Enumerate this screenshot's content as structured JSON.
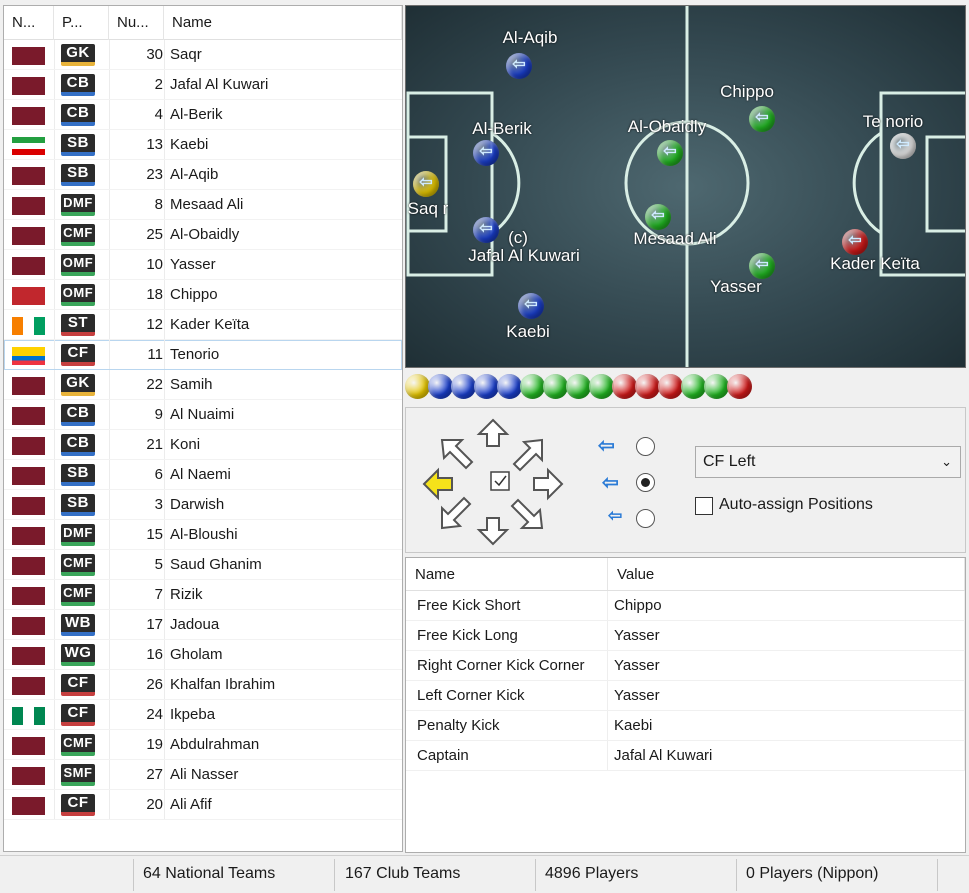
{
  "list_headers": [
    "N...",
    "P...",
    "Nu...",
    "Name"
  ],
  "players": [
    {
      "pos": "GK",
      "num": "30",
      "name": "Saqr",
      "cat": "gk",
      "flag": "maroon"
    },
    {
      "pos": "CB",
      "num": "2",
      "name": "Jafal Al Kuwari",
      "cat": "df",
      "flag": "maroon"
    },
    {
      "pos": "CB",
      "num": "4",
      "name": "Al-Berik",
      "cat": "df",
      "flag": "maroon"
    },
    {
      "pos": "SB",
      "num": "13",
      "name": "Kaebi",
      "cat": "df",
      "flag": "iran"
    },
    {
      "pos": "SB",
      "num": "23",
      "name": "Al-Aqib",
      "cat": "df",
      "flag": "maroon"
    },
    {
      "pos": "DMF",
      "num": "8",
      "name": "Mesaad Ali",
      "cat": "mf",
      "flag": "maroon"
    },
    {
      "pos": "CMF",
      "num": "25",
      "name": "Al-Obaidly",
      "cat": "mf",
      "flag": "maroon"
    },
    {
      "pos": "OMF",
      "num": "10",
      "name": "Yasser",
      "cat": "mf",
      "flag": "maroon"
    },
    {
      "pos": "OMF",
      "num": "18",
      "name": "Chippo",
      "cat": "mf",
      "flag": "morocco"
    },
    {
      "pos": "ST",
      "num": "12",
      "name": "Kader Keïta",
      "cat": "fw",
      "flag": "ivory"
    },
    {
      "pos": "CF",
      "num": "11",
      "name": "Tenorio",
      "cat": "fw",
      "flag": "ecuador"
    },
    {
      "pos": "GK",
      "num": "22",
      "name": "Samih",
      "cat": "gk",
      "flag": "maroon"
    },
    {
      "pos": "CB",
      "num": "9",
      "name": "Al Nuaimi",
      "cat": "df",
      "flag": "maroon"
    },
    {
      "pos": "CB",
      "num": "21",
      "name": "Koni",
      "cat": "df",
      "flag": "maroon"
    },
    {
      "pos": "SB",
      "num": "6",
      "name": "Al Naemi",
      "cat": "df",
      "flag": "maroon"
    },
    {
      "pos": "SB",
      "num": "3",
      "name": "Darwish",
      "cat": "df",
      "flag": "maroon"
    },
    {
      "pos": "DMF",
      "num": "15",
      "name": "Al-Bloushi",
      "cat": "mf",
      "flag": "maroon"
    },
    {
      "pos": "CMF",
      "num": "5",
      "name": "Saud Ghanim",
      "cat": "mf",
      "flag": "maroon"
    },
    {
      "pos": "CMF",
      "num": "7",
      "name": "Rizik",
      "cat": "mf",
      "flag": "maroon"
    },
    {
      "pos": "WB",
      "num": "17",
      "name": "Jadoua",
      "cat": "df",
      "flag": "maroon"
    },
    {
      "pos": "WG",
      "num": "16",
      "name": "Gholam",
      "cat": "mf",
      "flag": "maroon"
    },
    {
      "pos": "CF",
      "num": "26",
      "name": "Khalfan Ibrahim",
      "cat": "fw",
      "flag": "maroon"
    },
    {
      "pos": "CF",
      "num": "24",
      "name": "Ikpeba",
      "cat": "fw",
      "flag": "nigeria"
    },
    {
      "pos": "CMF",
      "num": "19",
      "name": "Abdulrahman",
      "cat": "mf",
      "flag": "maroon"
    },
    {
      "pos": "SMF",
      "num": "27",
      "name": "Ali Nasser",
      "cat": "mf",
      "flag": "maroon"
    },
    {
      "pos": "CF",
      "num": "20",
      "name": "Ali Afif",
      "cat": "fw",
      "flag": "maroon"
    }
  ],
  "selected_row": 10,
  "pitch_labels": [
    "Al-Aqib",
    "Chippo",
    "Al-Berik",
    "Al-Obaidly",
    "Te norio",
    "Saq r",
    "(c)",
    "Jafal Al Kuwari",
    "Mesaad Ali",
    "Kader Keïta",
    "Yasser",
    "Kaebi"
  ],
  "ball_colors": [
    "#e8c800",
    "#1a3fcf",
    "#1a3fcf",
    "#1a3fcf",
    "#1a3fcf",
    "#22b822",
    "#22b822",
    "#22b822",
    "#22b822",
    "#d41a1a",
    "#d41a1a",
    "#d41a1a",
    "#22b822",
    "#22b822",
    "#d41a1a"
  ],
  "controls": {
    "position_select": "CF Left",
    "auto_assign_label": "Auto-assign Positions",
    "auto_assign_checked": false,
    "radio_selected": 1
  },
  "props_headers": [
    "Name",
    "Value"
  ],
  "props": [
    {
      "k": "Free Kick Short",
      "v": "Chippo"
    },
    {
      "k": "Free Kick Long",
      "v": "Yasser"
    },
    {
      "k": "Right Corner Kick Corner",
      "v": "Yasser"
    },
    {
      "k": "Left Corner Kick",
      "v": "Yasser"
    },
    {
      "k": "Penalty Kick",
      "v": "Kaebi"
    },
    {
      "k": "Captain",
      "v": "Jafal Al Kuwari"
    }
  ],
  "status": [
    "64 National Teams",
    "167 Club Teams",
    "4896 Players",
    "0 Players (Nippon)"
  ]
}
